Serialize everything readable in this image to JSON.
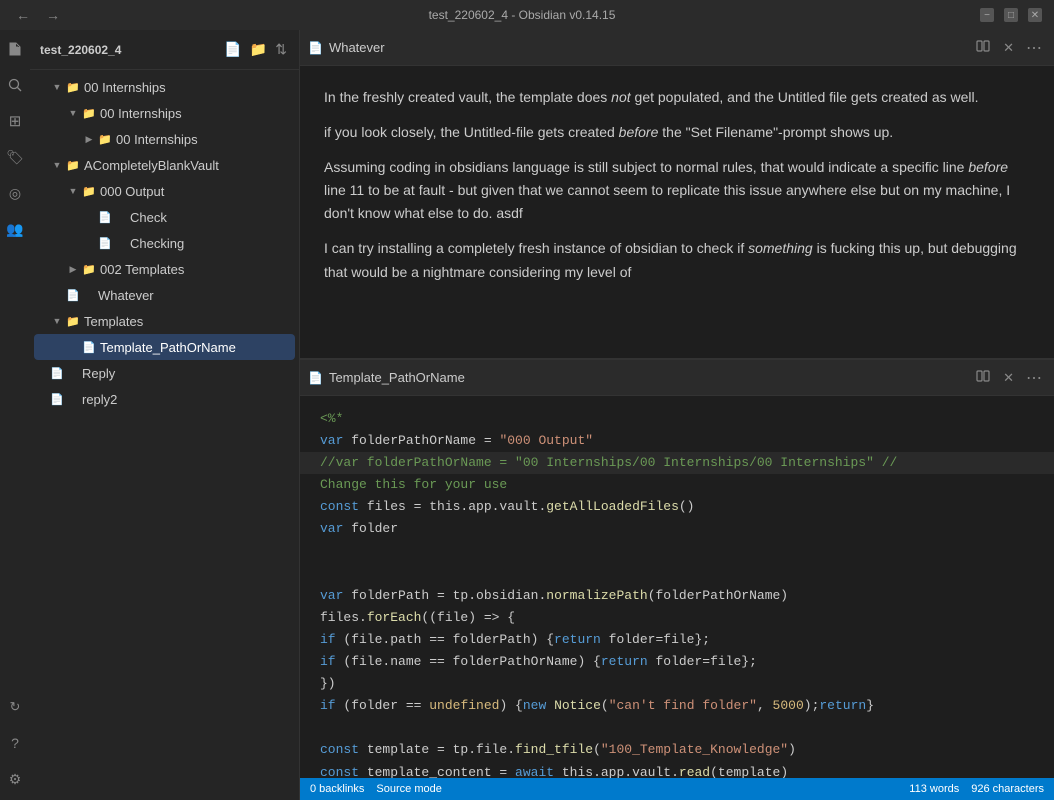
{
  "titlebar": {
    "title": "test_220602_4 - Obsidian v0.14.15",
    "back_btn": "←",
    "fwd_btn": "→",
    "min_btn": "−",
    "max_btn": "□",
    "close_btn": "✕"
  },
  "sidebar": {
    "vault_name": "test_220602_4",
    "items": [
      {
        "id": "internships-1",
        "label": "00 Internships",
        "indent": 1,
        "type": "folder",
        "open": true
      },
      {
        "id": "internships-2",
        "label": "00 Internships",
        "indent": 2,
        "type": "folder",
        "open": true
      },
      {
        "id": "internships-3",
        "label": "00 Internships",
        "indent": 3,
        "type": "folder",
        "open": false
      },
      {
        "id": "acompletely",
        "label": "ACompletelyBlankVault",
        "indent": 1,
        "type": "folder",
        "open": true
      },
      {
        "id": "000output",
        "label": "000 Output",
        "indent": 2,
        "type": "folder",
        "open": true
      },
      {
        "id": "check",
        "label": "Check",
        "indent": 3,
        "type": "file"
      },
      {
        "id": "checking",
        "label": "Checking",
        "indent": 3,
        "type": "file"
      },
      {
        "id": "002templates",
        "label": "002 Templates",
        "indent": 2,
        "type": "folder",
        "open": false
      },
      {
        "id": "whatever",
        "label": "Whatever",
        "indent": 2,
        "type": "file"
      },
      {
        "id": "templates",
        "label": "Templates",
        "indent": 1,
        "type": "folder",
        "open": true
      },
      {
        "id": "template-path",
        "label": "Template_PathOrName",
        "indent": 2,
        "type": "file",
        "active": true
      },
      {
        "id": "reply",
        "label": "Reply",
        "indent": 1,
        "type": "file"
      },
      {
        "id": "reply2",
        "label": "reply2",
        "indent": 1,
        "type": "file"
      }
    ]
  },
  "top_pane": {
    "title": "Whatever",
    "content": [
      "In the freshly created vault, the template does _not_ get populated, and the Untitled file gets created as well.",
      "if you look closely, the Untitled-file gets created _before_ the \"Set Filename\"-prompt shows up.",
      "Assuming coding in obsidians language is still subject to normal rules, that would indicate a specific line _before_ line 11 to be at fault - but given that we cannot seem to replicate this issue anywhere else but on my machine, I don't know what else to do. asdf",
      "I can try installing a completely fresh instance of obsidian to check if _something_ is fucking this up, but debugging that would be a nightmare considering my level of"
    ]
  },
  "bottom_pane": {
    "title": "Template_PathOrName",
    "code": [
      {
        "text": "<%*",
        "tokens": [
          {
            "type": "c-comment",
            "text": "<%*"
          }
        ]
      },
      {
        "text": "var folderPathOrName = \"000 Output\"",
        "tokens": [
          {
            "type": "c-var-kw",
            "text": "var "
          },
          {
            "type": "c-default",
            "text": "folderPathOrName "
          },
          {
            "type": "c-punct",
            "text": "= "
          },
          {
            "type": "c-string",
            "text": "\"000 Output\""
          }
        ]
      },
      {
        "text": "//var folderPathOrName = \"00 Internships/00 Internships/00 Internships\" //",
        "tokens": [
          {
            "type": "c-comment",
            "text": "//var folderPathOrName = \"00 Internships/00 Internships/00 Internships\" //"
          }
        ]
      },
      {
        "text": "Change this for your use",
        "tokens": [
          {
            "type": "c-comment",
            "text": "Change this for your use"
          }
        ]
      },
      {
        "text": "const files = this.app.vault.getAllLoadedFiles()",
        "tokens": [
          {
            "type": "c-var-kw",
            "text": "const "
          },
          {
            "type": "c-default",
            "text": "files = this.app.vault."
          },
          {
            "type": "c-func",
            "text": "getAllLoadedFiles"
          },
          {
            "type": "c-punct",
            "text": "()"
          }
        ]
      },
      {
        "text": "var folder",
        "tokens": [
          {
            "type": "c-var-kw",
            "text": "var "
          },
          {
            "type": "c-default",
            "text": "folder"
          }
        ]
      },
      {
        "text": "",
        "tokens": []
      },
      {
        "text": "",
        "tokens": []
      },
      {
        "text": "var folderPath = tp.obsidian.normalizePath(folderPathOrName)",
        "tokens": [
          {
            "type": "c-var-kw",
            "text": "var "
          },
          {
            "type": "c-default",
            "text": "folderPath = tp.obsidian."
          },
          {
            "type": "c-func",
            "text": "normalizePath"
          },
          {
            "type": "c-punct",
            "text": "(folderPathOrName)"
          }
        ]
      },
      {
        "text": "files.forEach((file) => {",
        "tokens": [
          {
            "type": "c-default",
            "text": "files."
          },
          {
            "type": "c-func",
            "text": "forEach"
          },
          {
            "type": "c-punct",
            "text": "((file) => {"
          }
        ]
      },
      {
        "text": "if (file.path == folderPath) {return folder=file};",
        "tokens": [
          {
            "type": "c-var-kw",
            "text": "if "
          },
          {
            "type": "c-punct",
            "text": "(file.path "
          },
          {
            "type": "c-default",
            "text": "== folderPath) {"
          },
          {
            "type": "c-var-kw",
            "text": "return "
          },
          {
            "type": "c-default",
            "text": "folder=file};"
          }
        ]
      },
      {
        "text": "if (file.name == folderPathOrName) {return folder=file};",
        "tokens": [
          {
            "type": "c-var-kw",
            "text": "if "
          },
          {
            "type": "c-punct",
            "text": "(file.name "
          },
          {
            "type": "c-default",
            "text": "== folderPathOrName) {"
          },
          {
            "type": "c-var-kw",
            "text": "return "
          },
          {
            "type": "c-default",
            "text": "folder=file};"
          }
        ]
      },
      {
        "text": "})",
        "tokens": [
          {
            "type": "c-punct",
            "text": "})"
          }
        ]
      },
      {
        "text": "if (folder == undefined) {new Notice(\"can't find folder\", 5000);return}",
        "tokens": [
          {
            "type": "c-var-kw",
            "text": "if "
          },
          {
            "type": "c-punct",
            "text": "(folder == "
          },
          {
            "type": "c-orange",
            "text": "undefined"
          },
          {
            "type": "c-punct",
            "text": ") {"
          },
          {
            "type": "c-var-kw",
            "text": "new "
          },
          {
            "type": "c-func",
            "text": "Notice"
          },
          {
            "type": "c-punct",
            "text": "("
          },
          {
            "type": "c-string",
            "text": "\"can't find folder\""
          },
          {
            "type": "c-punct",
            "text": ", "
          },
          {
            "type": "c-orange",
            "text": "5000"
          },
          {
            "type": "c-punct",
            "text": ");"
          },
          {
            "type": "c-var-kw",
            "text": "return"
          },
          {
            "type": "c-punct",
            "text": "}"
          }
        ]
      },
      {
        "text": "",
        "tokens": []
      },
      {
        "text": "const template = tp.file.find_tfile(\"100_Template_Knowledge\")",
        "tokens": [
          {
            "type": "c-var-kw",
            "text": "const "
          },
          {
            "type": "c-default",
            "text": "template = tp.file."
          },
          {
            "type": "c-func",
            "text": "find_tfile"
          },
          {
            "type": "c-punct",
            "text": "("
          },
          {
            "type": "c-string",
            "text": "\"100_Template_Knowledge\""
          },
          {
            "type": "c-punct",
            "text": ")"
          }
        ]
      },
      {
        "text": "const template_content = await this.app.vault.read(template)",
        "tokens": [
          {
            "type": "c-var-kw",
            "text": "const "
          },
          {
            "type": "c-default",
            "text": "template_content = "
          },
          {
            "type": "c-var-kw",
            "text": "await "
          },
          {
            "type": "c-default",
            "text": "this.app.vault."
          },
          {
            "type": "c-func",
            "text": "read"
          },
          {
            "type": "c-punct",
            "text": "(template)"
          }
        ]
      }
    ]
  },
  "status_bar": {
    "backlinks": "0 backlinks",
    "source_mode": "Source mode",
    "word_count": "113 words",
    "char_count": "926 characters"
  },
  "icons": {
    "folder": "📁",
    "file": "📄",
    "arrow_right": "▶",
    "arrow_down": "▼",
    "new_file": "📄",
    "new_folder": "📁",
    "sort": "⇅",
    "search": "🔍",
    "close": "✕",
    "more": "⋯"
  }
}
